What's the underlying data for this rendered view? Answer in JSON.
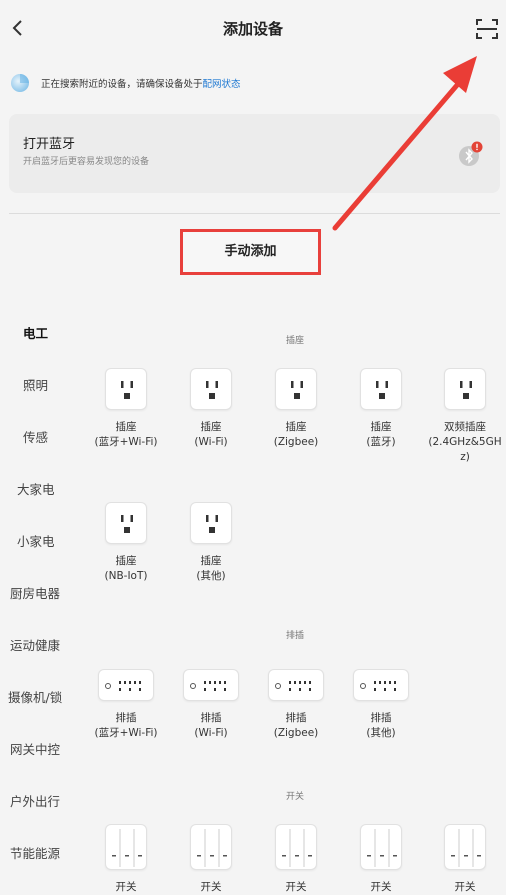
{
  "header": {
    "title": "添加设备"
  },
  "search": {
    "text": "正在搜索附近的设备，请确保设备处于",
    "link": "配网状态"
  },
  "bluetooth": {
    "title": "打开蓝牙",
    "subtitle": "开启蓝牙后更容易发现您的设备"
  },
  "manual_add": "手动添加",
  "categories": [
    "电工",
    "照明",
    "传感",
    "大家电",
    "小家电",
    "厨房电器",
    "运动健康",
    "摄像机/锁",
    "网关中控",
    "户外出行",
    "节能能源"
  ],
  "sections": {
    "socket": {
      "title": "插座",
      "items": [
        {
          "line1": "插座",
          "line2": "(蓝牙+Wi-Fi)",
          "line3": ""
        },
        {
          "line1": "插座",
          "line2": "(Wi-Fi)",
          "line3": ""
        },
        {
          "line1": "插座",
          "line2": "(Zigbee)",
          "line3": ""
        },
        {
          "line1": "插座",
          "line2": "(蓝牙)",
          "line3": ""
        },
        {
          "line1": "双频插座",
          "line2": "(2.4GHz&5GH",
          "line3": "z)"
        },
        {
          "line1": "插座",
          "line2": "(NB-IoT)",
          "line3": ""
        },
        {
          "line1": "插座",
          "line2": "(其他)",
          "line3": ""
        }
      ]
    },
    "strip": {
      "title": "排插",
      "items": [
        {
          "line1": "排插",
          "line2": "(蓝牙+Wi-Fi)"
        },
        {
          "line1": "排插",
          "line2": "(Wi-Fi)"
        },
        {
          "line1": "排插",
          "line2": "(Zigbee)"
        },
        {
          "line1": "排插",
          "line2": "(其他)"
        }
      ]
    },
    "switch": {
      "title": "开关",
      "items": [
        {
          "line1": "开关"
        },
        {
          "line1": "开关"
        },
        {
          "line1": "开关"
        },
        {
          "line1": "开关"
        },
        {
          "line1": "开关"
        }
      ]
    }
  },
  "colors": {
    "accent": "#1e78d2",
    "highlight": "#e8403c",
    "background": "#f4f4f4"
  }
}
